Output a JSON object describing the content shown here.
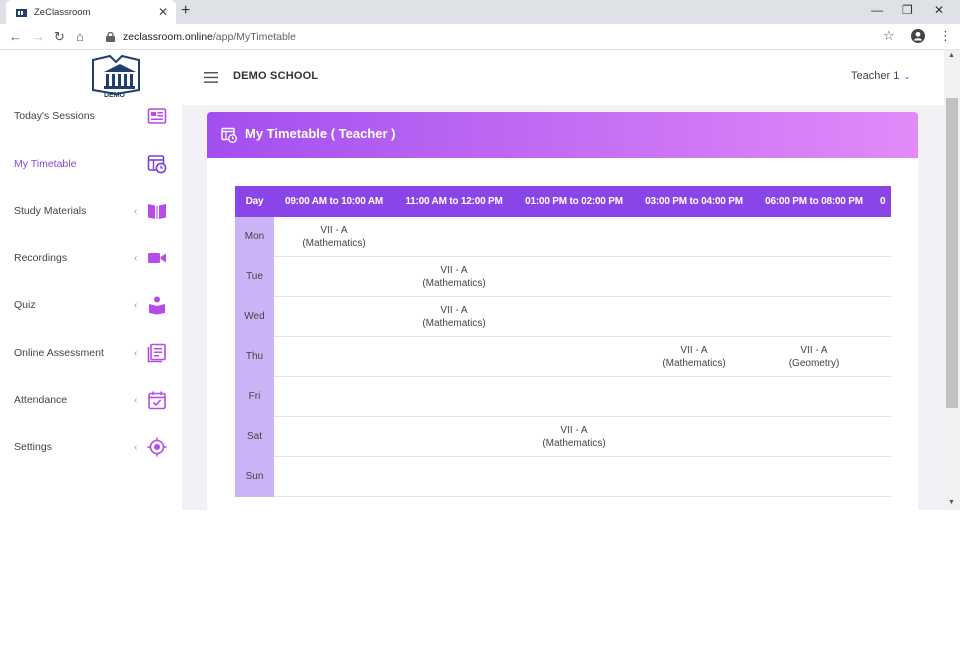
{
  "browser": {
    "tab_title": "ZeClassroom",
    "url_host": "zeclassroom.online",
    "url_path": "/app/MyTimetable"
  },
  "header": {
    "school_name": "DEMO SCHOOL",
    "user_name": "Teacher 1"
  },
  "logo_text": "DEMO",
  "sidebar": {
    "items": [
      {
        "label": "Today's Sessions",
        "icon": "sessions-icon",
        "expandable": false
      },
      {
        "label": "My Timetable",
        "icon": "timetable-icon",
        "expandable": false,
        "active": true
      },
      {
        "label": "Study Materials",
        "icon": "book-icon",
        "expandable": true
      },
      {
        "label": "Recordings",
        "icon": "video-icon",
        "expandable": true
      },
      {
        "label": "Quiz",
        "icon": "quiz-icon",
        "expandable": true
      },
      {
        "label": "Online Assessment",
        "icon": "assessment-icon",
        "expandable": true
      },
      {
        "label": "Attendance",
        "icon": "calendar-check-icon",
        "expandable": true
      },
      {
        "label": "Settings",
        "icon": "settings-icon",
        "expandable": true
      }
    ]
  },
  "card": {
    "title": "My Timetable ( Teacher )"
  },
  "timetable": {
    "day_header": "Day",
    "slots": [
      "09:00 AM to 10:00 AM",
      "11:00 AM to 12:00 PM",
      "01:00 PM to 02:00 PM",
      "03:00 PM to 04:00 PM",
      "06:00 PM to 08:00 PM",
      "0"
    ],
    "rows": [
      {
        "day": "Mon",
        "cells": [
          {
            "cls": "VII - A",
            "subject": "(Mathematics)"
          },
          null,
          null,
          null,
          null
        ]
      },
      {
        "day": "Tue",
        "cells": [
          null,
          {
            "cls": "VII - A",
            "subject": "(Mathematics)"
          },
          null,
          null,
          null
        ]
      },
      {
        "day": "Wed",
        "cells": [
          null,
          {
            "cls": "VII - A",
            "subject": "(Mathematics)"
          },
          null,
          null,
          null
        ]
      },
      {
        "day": "Thu",
        "cells": [
          null,
          null,
          null,
          {
            "cls": "VII - A",
            "subject": "(Mathematics)"
          },
          {
            "cls": "VII - A",
            "subject": "(Geometry)"
          }
        ]
      },
      {
        "day": "Fri",
        "cells": [
          null,
          null,
          null,
          null,
          null
        ]
      },
      {
        "day": "Sat",
        "cells": [
          null,
          null,
          {
            "cls": "VII - A",
            "subject": "(Mathematics)"
          },
          null,
          null
        ]
      },
      {
        "day": "Sun",
        "cells": [
          null,
          null,
          null,
          null,
          null
        ]
      }
    ]
  },
  "colors": {
    "accent": "#8a45e8",
    "day_col": "#cbb3f5",
    "header_grad_start": "#a24ff0",
    "header_grad_end": "#e28af8"
  }
}
